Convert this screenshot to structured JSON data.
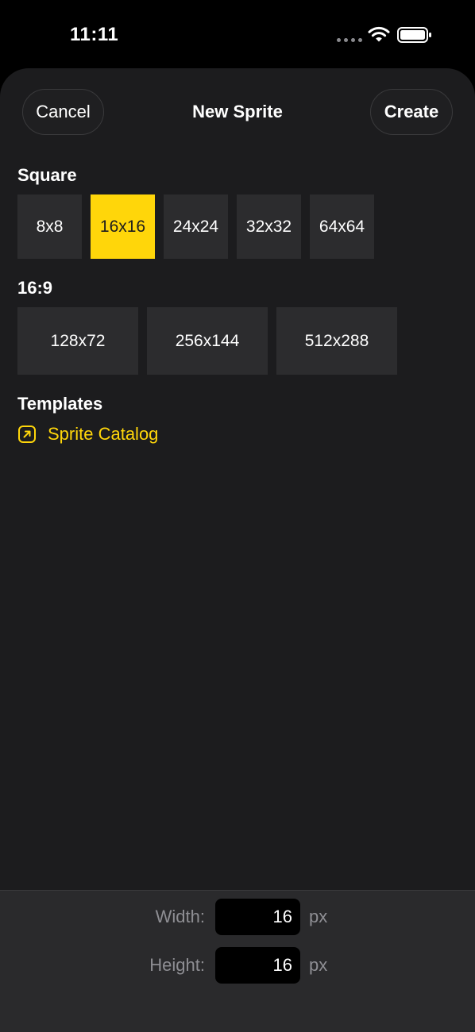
{
  "status_bar": {
    "time": "11:11"
  },
  "nav": {
    "cancel_label": "Cancel",
    "title": "New Sprite",
    "create_label": "Create"
  },
  "square": {
    "title": "Square",
    "options": [
      "8x8",
      "16x16",
      "24x24",
      "32x32",
      "64x64"
    ],
    "selected": "16x16"
  },
  "wide": {
    "title": "16:9",
    "options": [
      "128x72",
      "256x144",
      "512x288"
    ]
  },
  "templates": {
    "title": "Templates",
    "link_label": "Sprite Catalog",
    "link_icon": "arrow-up-right-square-icon"
  },
  "dimensions": {
    "width_label": "Width:",
    "width_value": "16",
    "height_label": "Height:",
    "height_value": "16",
    "unit": "px"
  },
  "colors": {
    "accent": "#ffd60a",
    "sheet_background": "#1c1c1e",
    "tile_background": "#2c2c2e"
  }
}
